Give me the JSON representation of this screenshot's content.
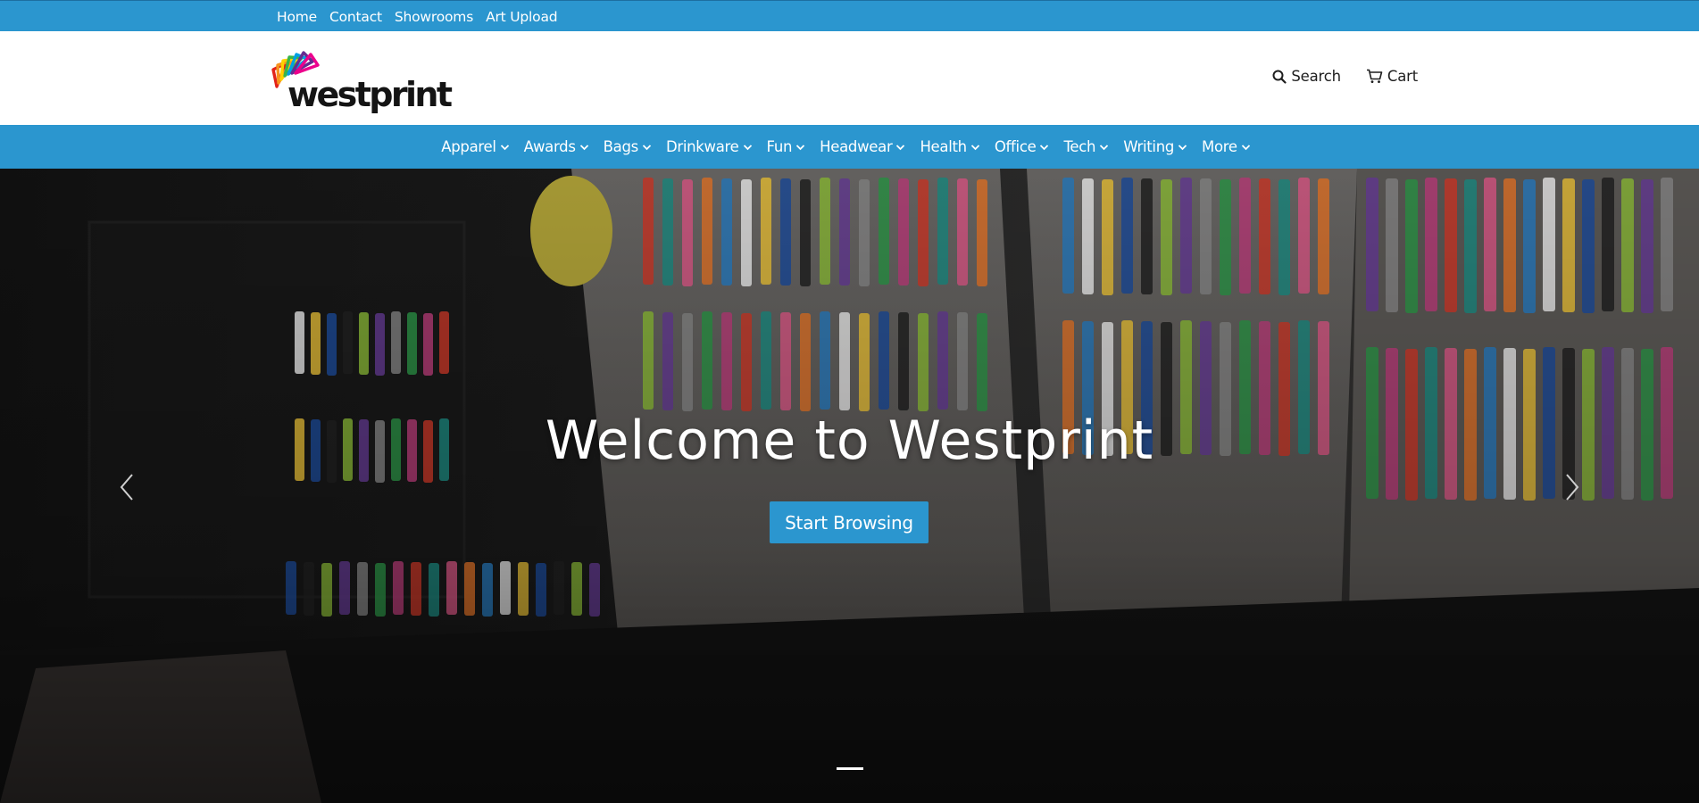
{
  "topbar": {
    "links": [
      "Home",
      "Contact",
      "Showrooms",
      "Art Upload"
    ],
    "color": "#2b96cf"
  },
  "header": {
    "logo_text": "westprint",
    "search_label": "Search",
    "cart_label": "Cart",
    "search_icon": "search-icon",
    "cart_icon": "cart-icon"
  },
  "categories": [
    "Apparel",
    "Awards",
    "Bags",
    "Drinkware",
    "Fun",
    "Headwear",
    "Health",
    "Office",
    "Tech",
    "Writing",
    "More"
  ],
  "hero": {
    "title": "Welcome to Westprint",
    "button_label": "Start Browsing",
    "prev_icon": "chevron-left-icon",
    "next_icon": "chevron-right-icon",
    "slides_count_visible": 1
  },
  "colors": {
    "brand_blue": "#2b96cf",
    "text_dark": "#1e1e1e"
  }
}
